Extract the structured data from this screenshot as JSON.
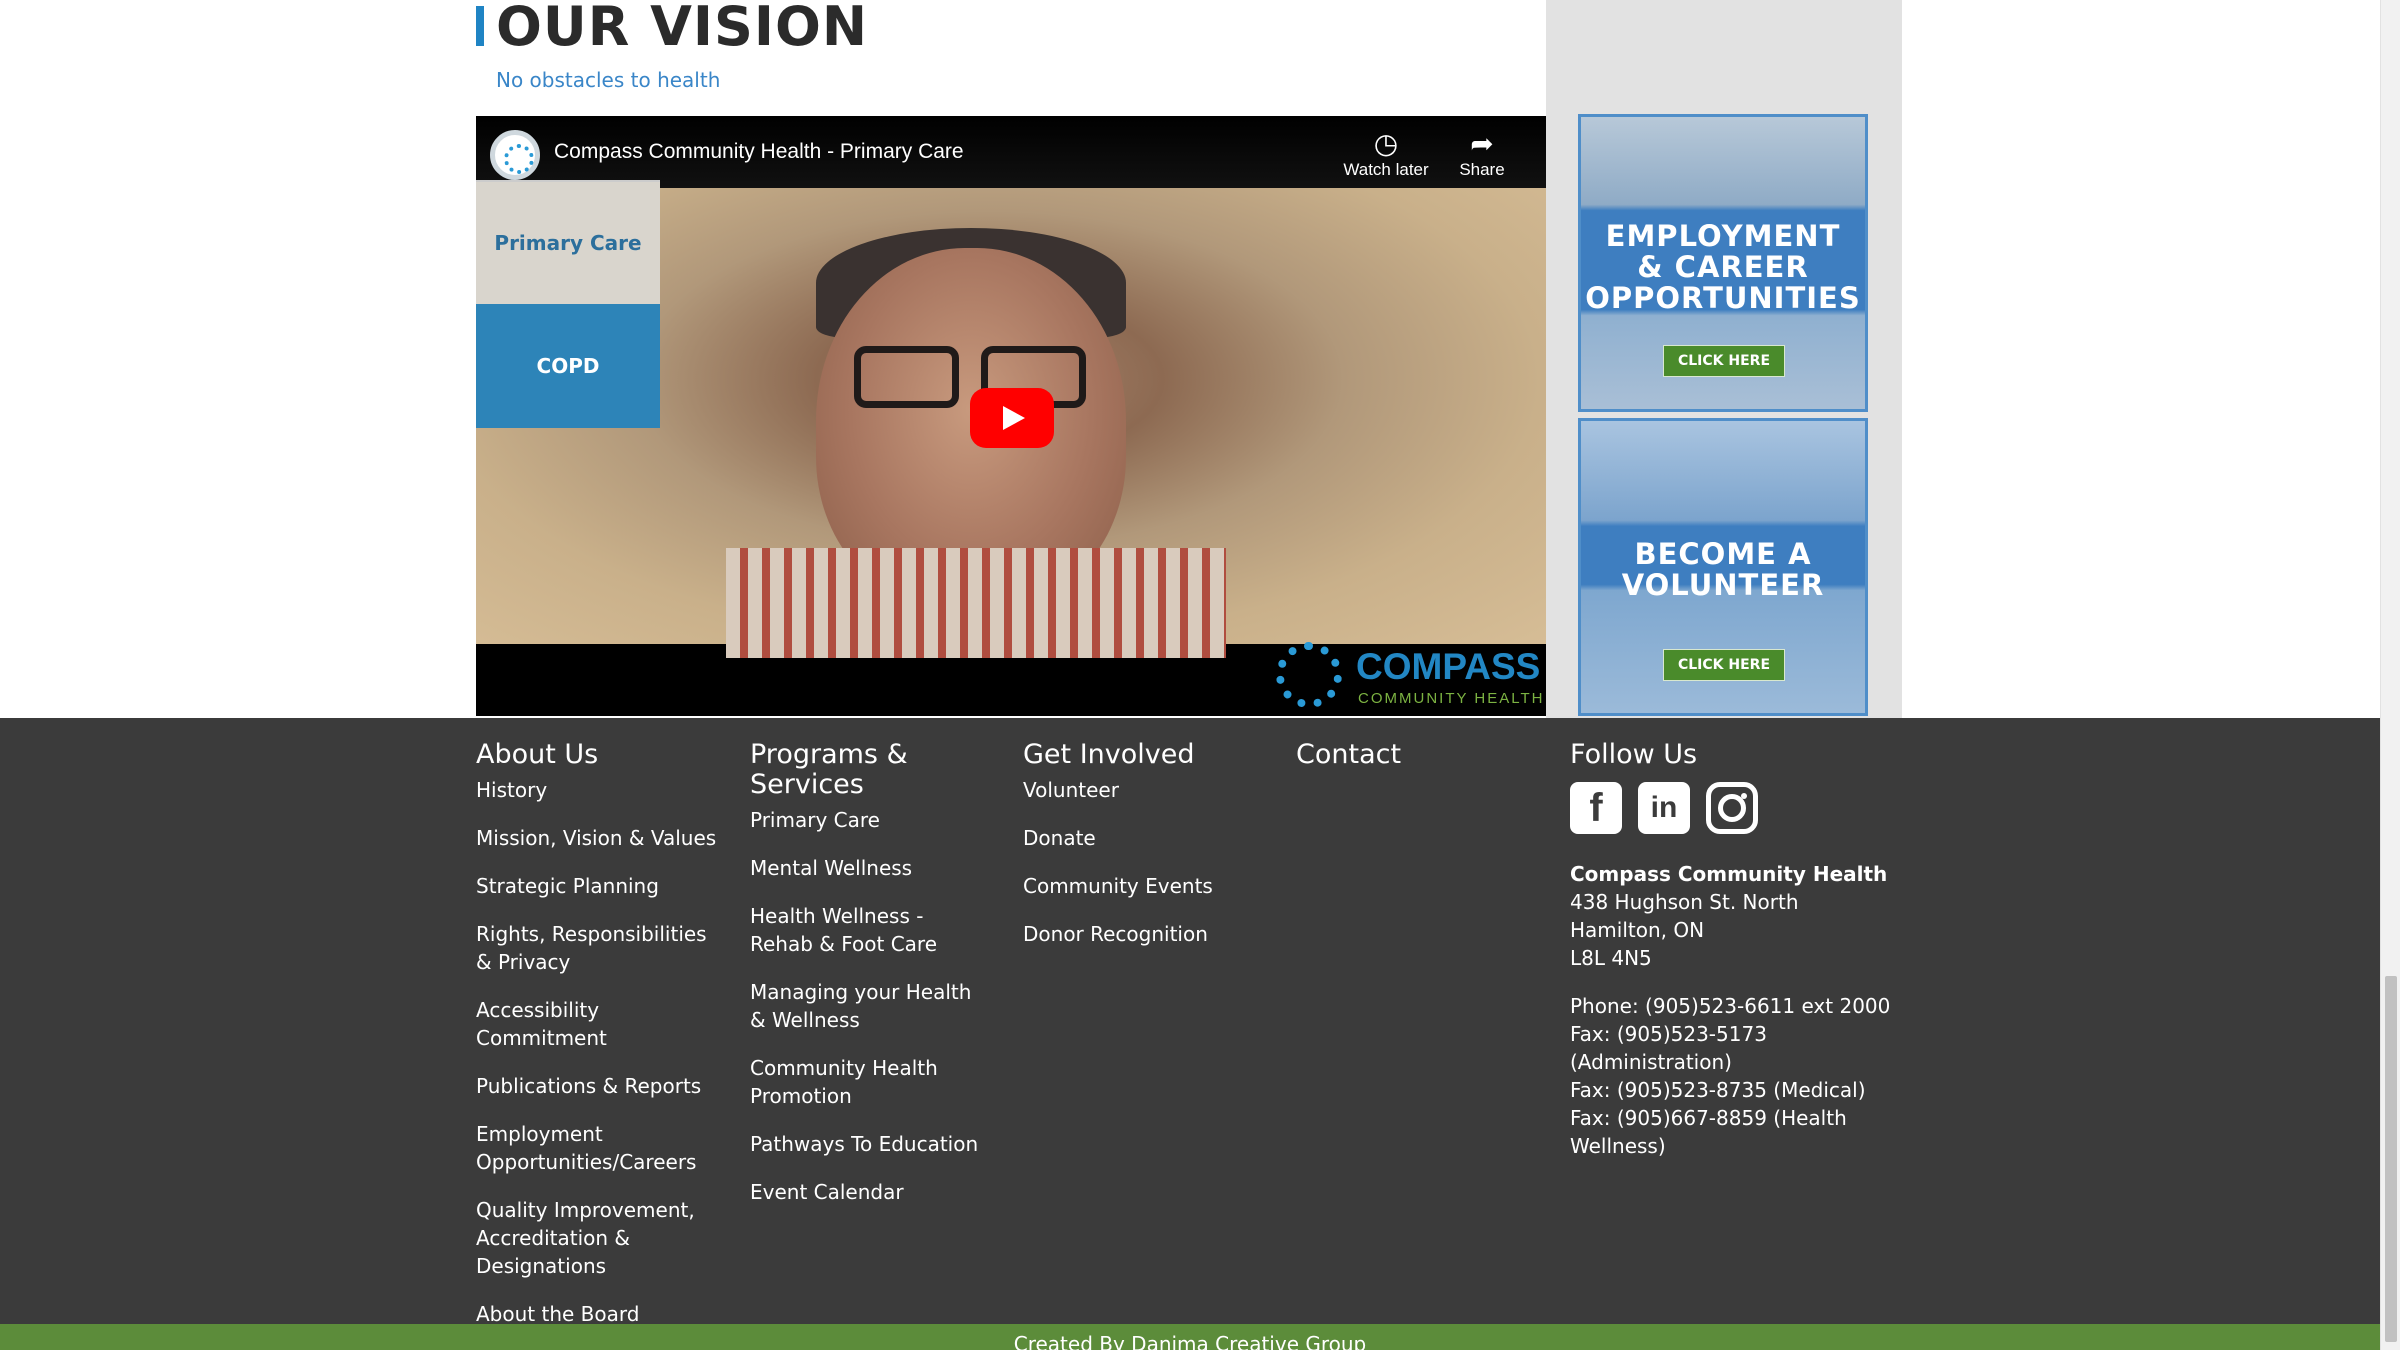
{
  "vision": {
    "title": "OUR VISION",
    "subtitle": "No obstacles to health"
  },
  "video": {
    "title": "Compass Community Health - Primary Care",
    "watch_later": "Watch later",
    "share": "Share",
    "watermark_word": "COMPASS",
    "watermark_sub": "COMMUNITY HEALTH",
    "playlist": [
      "Primary Care",
      "COPD"
    ]
  },
  "banners": {
    "employment": {
      "line1": "EMPLOYMENT",
      "line2": "& CAREER",
      "line3": "OPPORTUNITIES",
      "button": "CLICK HERE"
    },
    "volunteer": {
      "line1": "BECOME A",
      "line2": "VOLUNTEER",
      "button": "CLICK HERE"
    }
  },
  "footer": {
    "about": {
      "heading": "About Us",
      "links": [
        "History",
        "Mission, Vision & Values",
        "Strategic Planning",
        "Rights, Responsibilities & Privacy",
        "Accessibility Commitment",
        "Publications & Reports",
        "Employment Opportunities/Careers",
        "Quality Improvement, Accreditation & Designations",
        "About the Board"
      ]
    },
    "programs": {
      "heading": "Programs & Services",
      "links": [
        "Primary Care",
        "Mental Wellness",
        "Health Wellness - Rehab & Foot Care",
        "Managing your Health & Wellness",
        "Community Health Promotion",
        "Pathways To Education",
        "Event Calendar"
      ]
    },
    "involved": {
      "heading": "Get Involved",
      "links": [
        "Volunteer",
        "Donate",
        "Community Events",
        "Donor Recognition"
      ]
    },
    "contact": {
      "heading": "Contact"
    },
    "follow": {
      "heading": "Follow Us",
      "social_icons": [
        "facebook-icon",
        "linkedin-icon",
        "instagram-icon"
      ],
      "org_name": "Compass Community Health",
      "address": [
        "438 Hughson St. North",
        "Hamilton, ON",
        "L8L 4N5"
      ],
      "phones": [
        "Phone: (905)523-6611 ext 2000",
        "Fax: (905)523-5173 (Administration)",
        "Fax: (905)523-8735 (Medical)",
        "Fax: (905)667-8859 (Health Wellness)"
      ]
    },
    "credit": "Created By Danima Creative Group"
  },
  "colors": {
    "accent_blue": "#1f84c4",
    "footer_bg": "#3b3b3b",
    "credit_bar": "#5c8c3a",
    "button_green": "#4a8b2b"
  }
}
